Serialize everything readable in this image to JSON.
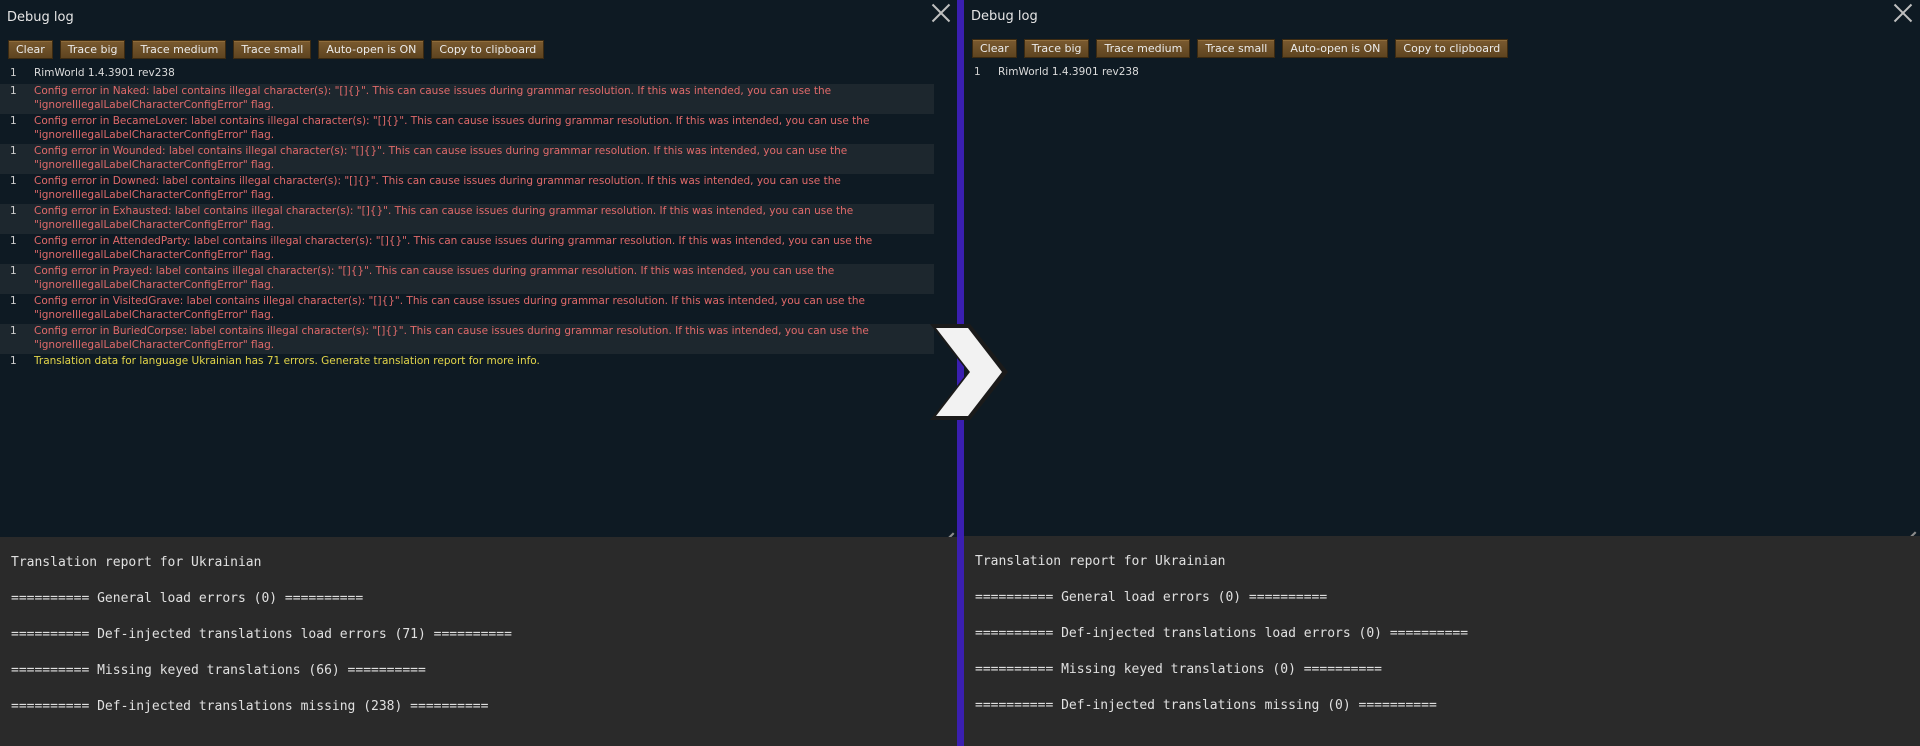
{
  "left": {
    "title": "Debug log",
    "buttons": [
      "Clear",
      "Trace big",
      "Trace medium",
      "Trace small",
      "Auto-open is ON",
      "Copy to clipboard"
    ],
    "log": [
      {
        "num": "1",
        "text": "RimWorld 1.4.3901 rev238",
        "type": "plain"
      },
      {
        "num": "1",
        "text": "Config error in Naked: label contains illegal character(s): \"[]{}\". This can cause issues during grammar resolution. If this was intended, you can use the \"ignoreIllegalLabelCharacterConfigError\" flag.",
        "type": "err"
      },
      {
        "num": "1",
        "text": "Config error in BecameLover: label contains illegal character(s): \"[]{}\". This can cause issues during grammar resolution. If this was intended, you can use the \"ignoreIllegalLabelCharacterConfigError\" flag.",
        "type": "err"
      },
      {
        "num": "1",
        "text": "Config error in Wounded: label contains illegal character(s): \"[]{}\". This can cause issues during grammar resolution. If this was intended, you can use the \"ignoreIllegalLabelCharacterConfigError\" flag.",
        "type": "err"
      },
      {
        "num": "1",
        "text": "Config error in Downed: label contains illegal character(s): \"[]{}\". This can cause issues during grammar resolution. If this was intended, you can use the \"ignoreIllegalLabelCharacterConfigError\" flag.",
        "type": "err"
      },
      {
        "num": "1",
        "text": "Config error in Exhausted: label contains illegal character(s): \"[]{}\". This can cause issues during grammar resolution. If this was intended, you can use the \"ignoreIllegalLabelCharacterConfigError\" flag.",
        "type": "err"
      },
      {
        "num": "1",
        "text": "Config error in AttendedParty: label contains illegal character(s): \"[]{}\". This can cause issues during grammar resolution. If this was intended, you can use the \"ignoreIllegalLabelCharacterConfigError\" flag.",
        "type": "err"
      },
      {
        "num": "1",
        "text": "Config error in Prayed: label contains illegal character(s): \"[]{}\". This can cause issues during grammar resolution. If this was intended, you can use the \"ignoreIllegalLabelCharacterConfigError\" flag.",
        "type": "err"
      },
      {
        "num": "1",
        "text": "Config error in VisitedGrave: label contains illegal character(s): \"[]{}\". This can cause issues during grammar resolution. If this was intended, you can use the \"ignoreIllegalLabelCharacterConfigError\" flag.",
        "type": "err"
      },
      {
        "num": "1",
        "text": "Config error in BuriedCorpse: label contains illegal character(s): \"[]{}\". This can cause issues during grammar resolution. If this was intended, you can use the \"ignoreIllegalLabelCharacterConfigError\" flag.",
        "type": "err"
      },
      {
        "num": "1",
        "text": "Translation data for language Ukrainian has 71 errors. Generate translation report for more info.",
        "type": "warn"
      }
    ],
    "report": [
      "Translation report for Ukrainian",
      "========== General load errors (0) ==========",
      "========== Def-injected translations load errors (71) ==========",
      "========== Missing keyed translations (66) ==========",
      "========== Def-injected translations missing (238) =========="
    ]
  },
  "right": {
    "title": "Debug log",
    "buttons": [
      "Clear",
      "Trace big",
      "Trace medium",
      "Trace small",
      "Auto-open is ON",
      "Copy to clipboard"
    ],
    "log": [
      {
        "num": "1",
        "text": "RimWorld 1.4.3901 rev238",
        "type": "plain"
      }
    ],
    "report": [
      "Translation report for Ukrainian",
      "========== General load errors (0) ==========",
      "========== Def-injected translations load errors (0) ==========",
      "========== Missing keyed translations (0) ==========",
      "========== Def-injected translations missing (0) =========="
    ]
  },
  "colors": {
    "error": "#e06a6a",
    "warning": "#e3d54a",
    "divider": "#3a1fb0",
    "button": "#6b4e27"
  },
  "icons": [
    "close-icon",
    "resize-grip-icon",
    "chevron-right-icon"
  ]
}
